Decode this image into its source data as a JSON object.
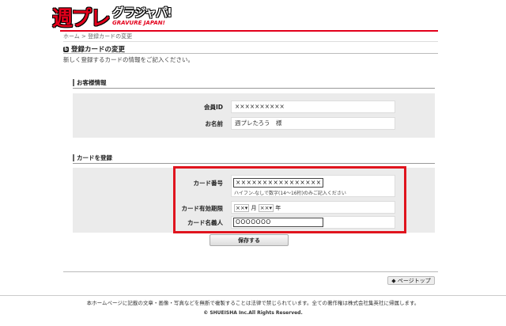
{
  "logo": {
    "mark": "週プレ",
    "text_jp": "グラジャパ!",
    "text_en": "GRAVURE JAPAN!"
  },
  "breadcrumb": {
    "home": "ホーム",
    "separator": ">",
    "current": "登録カードの変更"
  },
  "page": {
    "title_icon": "ⓑ",
    "title": "登録カードの変更",
    "intro": "新しく登録するカードの情報をご記入ください。"
  },
  "customer": {
    "heading": "お客様情報",
    "member_id_label": "会員ID",
    "member_id_value": "××××××××××",
    "name_label": "お名前",
    "name_value": "週プレたろう　様"
  },
  "card": {
    "heading": "カードを登録",
    "number_label": "カード番号",
    "number_value": "××××××××××××××××",
    "number_hint": "ハイフン-なしで数字(14～16桁)のみご記入ください",
    "expiry_label": "カード有効期限",
    "expiry_month": "××",
    "expiry_month_unit": "月",
    "expiry_year": "××",
    "expiry_year_unit": "年",
    "holder_label": "カード名義人",
    "holder_value": "OOOOOOO"
  },
  "actions": {
    "save_label": "保存する",
    "pagetop_label": "ページトップ",
    "pagetop_icon": "◆"
  },
  "footer": {
    "notice": "本ホームページに記載の文章・画像・写真などを無断で複製することは法律で禁じられています。全ての著作権は株式会社集英社に帰属します。",
    "copyright": "© SHUEISHA Inc.All Rights Reserved."
  },
  "colors": {
    "accent": "#e3001b",
    "highlight": "#e0141e"
  },
  "icons": {
    "title": "title-badge-icon",
    "section": "section-bar-icon",
    "dropdown": "dropdown-arrow-icon"
  }
}
